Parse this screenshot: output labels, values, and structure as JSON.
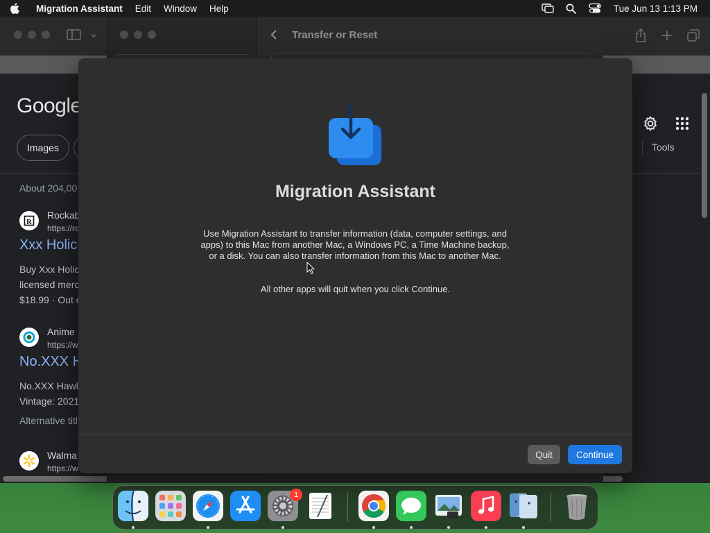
{
  "menubar": {
    "app_name": "Migration Assistant",
    "menus": [
      "Edit",
      "Window",
      "Help"
    ],
    "clock": "Tue Jun 13  1:13 PM",
    "status_icons": [
      "screen-mirroring-icon",
      "spotlight-search-icon",
      "control-center-icon"
    ]
  },
  "safari": {
    "google_logo": "Google",
    "chip_images": "Images",
    "about_results": "About 204,00",
    "tools_label": "Tools",
    "results": [
      {
        "site_name": "Rockab",
        "site_url": "https://ro",
        "title": "Xxx Holic",
        "line1": "Buy Xxx Holic",
        "line2": "licensed merc",
        "line3": "$18.99 · Out o"
      },
      {
        "site_name": "Anime",
        "site_url": "https://w",
        "title": "No.XXX H",
        "line1": "No.XXX Hawl",
        "line2": "Vintage: 2021",
        "line3": "Alternative titl"
      },
      {
        "site_name": "Walma",
        "site_url": "https://w"
      }
    ]
  },
  "ma_window": {
    "title": "Transfer or Reset"
  },
  "dialog": {
    "title": "Migration Assistant",
    "body": "Use Migration Assistant to transfer information (data, computer settings, and apps) to this Mac from another Mac, a Windows PC, a Time Machine backup, or a disk. You can also transfer information from this Mac to another Mac.",
    "note": "All other apps will quit when you click Continue.",
    "quit_label": "Quit",
    "continue_label": "Continue",
    "accent_color": "#1e78e0"
  },
  "dock": {
    "items": [
      "finder",
      "launchpad",
      "safari",
      "app-store",
      "system-settings",
      "textedit",
      "chrome",
      "messages",
      "preview",
      "music",
      "migration-assistant",
      "trash"
    ],
    "system_settings_badge": "1"
  }
}
